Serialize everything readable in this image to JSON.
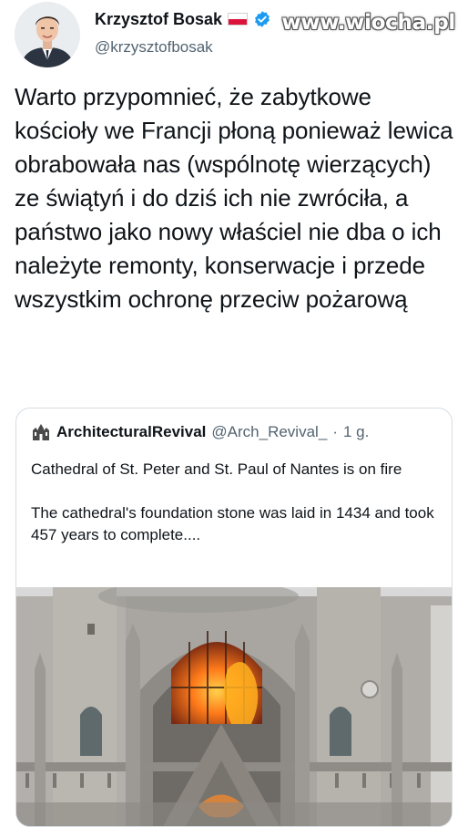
{
  "author": {
    "display_name": "Krzysztof Bosak",
    "handle": "@krzysztofbosak",
    "flag_icon": "poland-flag-icon",
    "verified_icon": "verified-badge-icon",
    "verified_color": "#1d9bf0"
  },
  "watermark": "www.wiocha.pl",
  "tweet_text": "Warto przypomnieć, że zabytkowe kościoły we Francji płoną ponieważ lewica obrabowała nas (wspólnotę wierzących) ze świątyń i do dziś ich nie zwróciła, a państwo jako nowy właściel nie dba o ich należyte remonty, konserwacje i przede wszystkim ochronę przeciw pożarową",
  "quoted": {
    "display_name": "ArchitecturalRevival",
    "handle": "@Arch_Revival_",
    "separator": "·",
    "time": "1 g.",
    "paragraph_1": "Cathedral of St. Peter and St. Paul of Nantes is on fire",
    "paragraph_2": "The cathedral's foundation stone was laid in 1434 and took 457 years to complete...."
  },
  "colors": {
    "text": "#0f1419",
    "secondary": "#536471",
    "border": "#d6dde2",
    "fire": "#ff7a1a"
  }
}
